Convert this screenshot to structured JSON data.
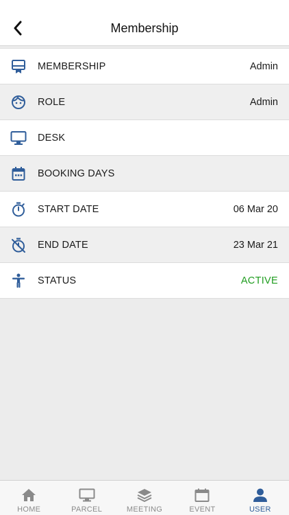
{
  "header": {
    "title": "Membership"
  },
  "colors": {
    "accent": "#2f5d9a",
    "status_active": "#1f9d1f",
    "inactive_tab": "#8a8a8a"
  },
  "rows": [
    {
      "icon": "card-icon",
      "label": "MEMBERSHIP",
      "value": "Admin"
    },
    {
      "icon": "face-icon",
      "label": "ROLE",
      "value": "Admin"
    },
    {
      "icon": "monitor-icon",
      "label": "DESK",
      "value": ""
    },
    {
      "icon": "calendar-icon",
      "label": "BOOKING DAYS",
      "value": ""
    },
    {
      "icon": "stopwatch-icon",
      "label": "START DATE",
      "value": "06 Mar 20"
    },
    {
      "icon": "timer-off-icon",
      "label": "END DATE",
      "value": "23 Mar 21"
    },
    {
      "icon": "person-icon",
      "label": "STATUS",
      "value": "ACTIVE"
    }
  ],
  "tabs": [
    {
      "icon": "home-icon",
      "label": "HOME"
    },
    {
      "icon": "monitor-icon",
      "label": "PARCEL"
    },
    {
      "icon": "layers-icon",
      "label": "MEETING"
    },
    {
      "icon": "calendar-icon",
      "label": "EVENT"
    },
    {
      "icon": "user-icon",
      "label": "USER",
      "active": true
    }
  ]
}
